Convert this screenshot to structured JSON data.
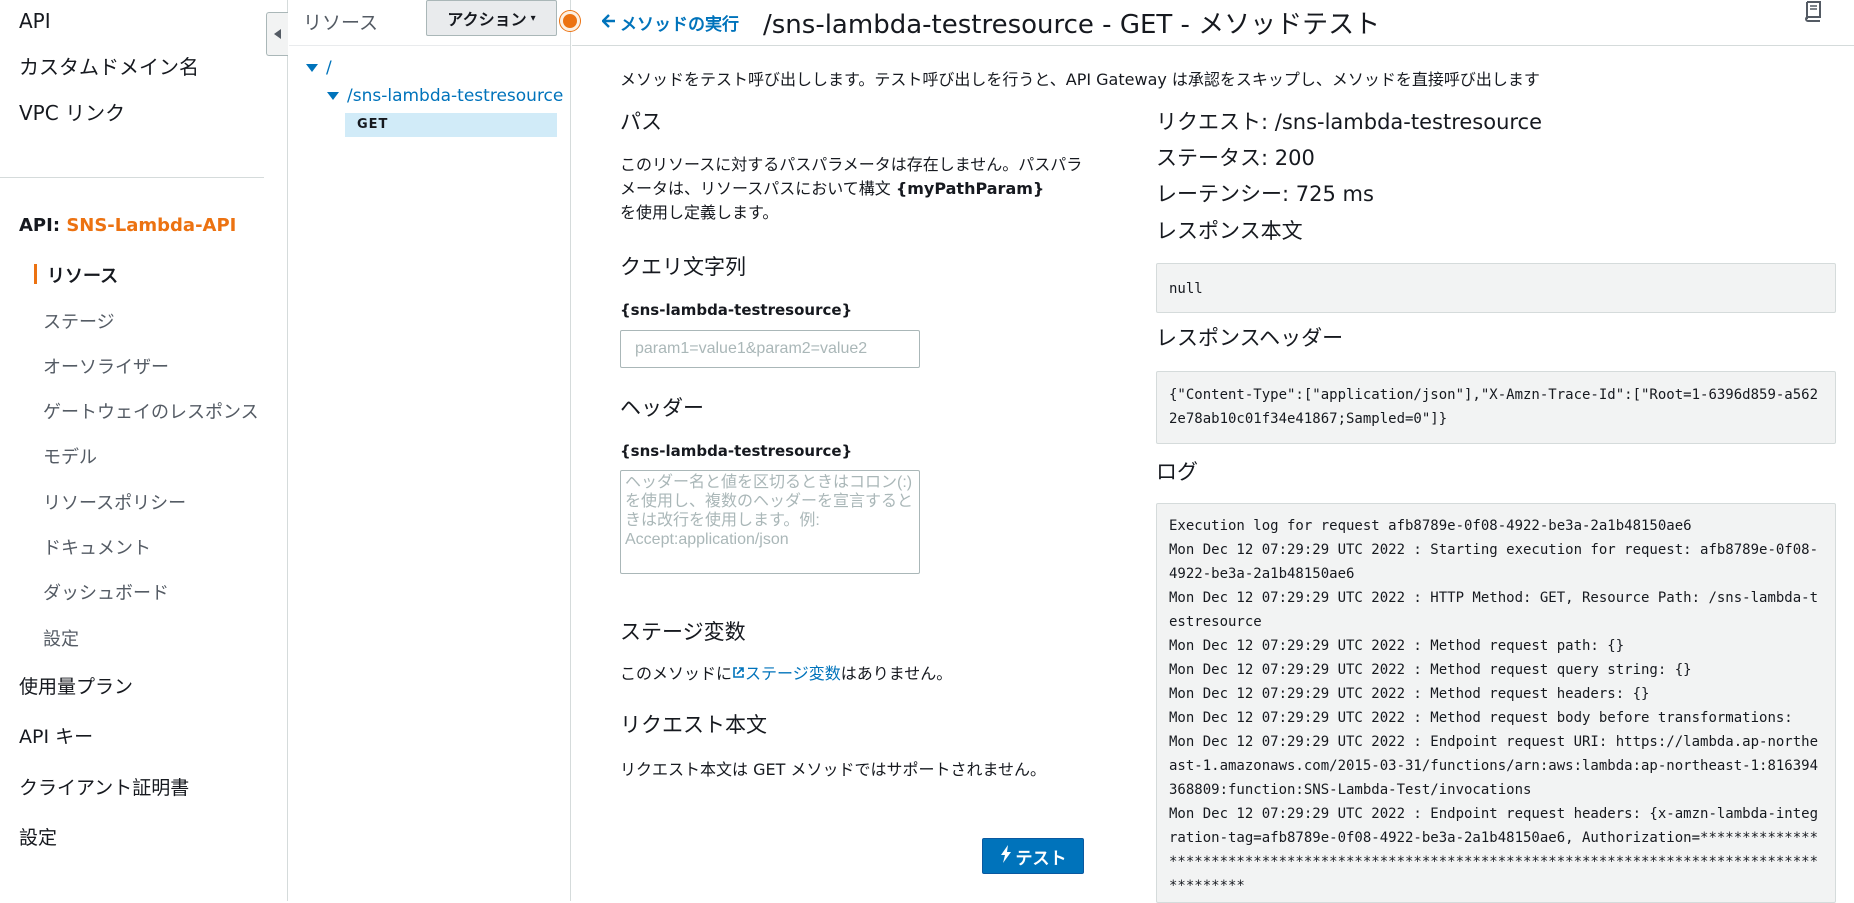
{
  "nav": {
    "top_items": [
      "API",
      "カスタムドメイン名",
      "VPC リンク"
    ],
    "api_prefix": "API:",
    "api_name": "SNS-Lambda-API",
    "sub_items": [
      "リソース",
      "ステージ",
      "オーソライザー",
      "ゲートウェイのレスポンス",
      "モデル",
      "リソースポリシー",
      "ドキュメント",
      "ダッシュボード",
      "設定"
    ],
    "bottom_items": [
      "使用量プラン",
      "API キー",
      "クライアント証明書",
      "設定"
    ]
  },
  "resources": {
    "title": "リソース",
    "actions_label": "アクション",
    "tree": {
      "root": "/",
      "child": "/sns-lambda-testresource",
      "method": "GET"
    }
  },
  "header": {
    "back_label": "メソッドの実行",
    "title": "/sns-lambda-testresource - GET - メソッドテスト"
  },
  "intro": "メソッドをテスト呼び出しします。テスト呼び出しを行うと、API Gateway は承認をスキップし、メソッドを直接呼び出します",
  "path": {
    "heading": "パス",
    "text_1": "このリソースに対するパスパラメータは存在しません。パスパラメータは、リソースパスにおいて構文",
    "param_token": "{myPathParam}",
    "text_2": "を使用し定義します。"
  },
  "query": {
    "heading": "クエリ文字列",
    "label": "{sns-lambda-testresource}",
    "placeholder": "param1=value1&param2=value2"
  },
  "headers": {
    "heading": "ヘッダー",
    "label": "{sns-lambda-testresource}",
    "placeholder": "ヘッダー名と値を区切るときはコロン(:) を使用し、複数のヘッダーを宣言するときは改行を使用します。例: Accept:application/json"
  },
  "stage_vars": {
    "heading": "ステージ変数",
    "text_before": "このメソッドに",
    "link": "ステージ変数",
    "text_after": "はありません。"
  },
  "request_body": {
    "heading": "リクエスト本文",
    "text": "リクエスト本文は GET メソッドではサポートされません。"
  },
  "test_button": "テスト",
  "result": {
    "request": "リクエスト: /sns-lambda-testresource",
    "status": "ステータス: 200",
    "latency": "レーテンシー: 725 ms",
    "response_body_heading": "レスポンス本文",
    "response_body": "null",
    "response_headers_heading": "レスポンスヘッダー",
    "response_headers": "{\"Content-Type\":[\"application/json\"],\"X-Amzn-Trace-Id\":[\"Root=1-6396d859-a5622e78ab10c01f34e41867;Sampled=0\"]}",
    "log_heading": "ログ",
    "log": "Execution log for request afb8789e-0f08-4922-be3a-2a1b48150ae6\nMon Dec 12 07:29:29 UTC 2022 : Starting execution for request: afb8789e-0f08-4922-be3a-2a1b48150ae6\nMon Dec 12 07:29:29 UTC 2022 : HTTP Method: GET, Resource Path: /sns-lambda-testresource\nMon Dec 12 07:29:29 UTC 2022 : Method request path: {}\nMon Dec 12 07:29:29 UTC 2022 : Method request query string: {}\nMon Dec 12 07:29:29 UTC 2022 : Method request headers: {}\nMon Dec 12 07:29:29 UTC 2022 : Method request body before transformations:\nMon Dec 12 07:29:29 UTC 2022 : Endpoint request URI: https://lambda.ap-northeast-1.amazonaws.com/2015-03-31/functions/arn:aws:lambda:ap-northeast-1:816394368809:function:SNS-Lambda-Test/invocations\nMon Dec 12 07:29:29 UTC 2022 : Endpoint request headers: {x-amzn-lambda-integration-tag=afb8789e-0f08-4922-be3a-2a1b48150ae6, Authorization=****************************************************************************************************"
  },
  "colors": {
    "accent": "#ec7211",
    "link": "#0073bb",
    "selected_row": "#d1ebf8"
  }
}
